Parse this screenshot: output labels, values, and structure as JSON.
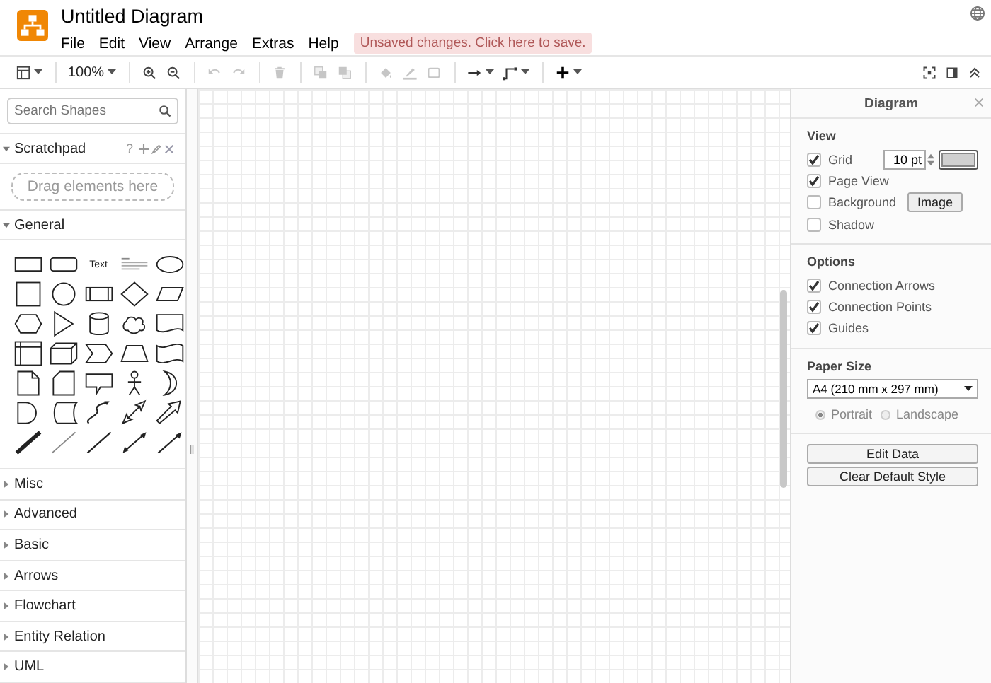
{
  "header": {
    "title": "Untitled Diagram",
    "menu": [
      "File",
      "Edit",
      "View",
      "Arrange",
      "Extras",
      "Help"
    ],
    "notice": "Unsaved changes. Click here to save."
  },
  "toolbar": {
    "zoom": "100%",
    "buttons": [
      {
        "disabled": false
      },
      {
        "disabled": false
      },
      {
        "disabled": false
      },
      {
        "disabled": true
      },
      {
        "disabled": true
      },
      {
        "disabled": true
      },
      {
        "disabled": true
      },
      {
        "disabled": true
      },
      {
        "disabled": true
      },
      {
        "disabled": true
      },
      {
        "disabled": true
      },
      {
        "disabled": false
      },
      {
        "disabled": false
      },
      {
        "disabled": false
      }
    ]
  },
  "sidebar": {
    "search": {
      "placeholder": "Search Shapes"
    },
    "scratchpad": {
      "title": "Scratchpad",
      "help": "?",
      "drop_hint": "Drag elements here",
      "expanded": true
    },
    "general": {
      "title": "General",
      "expanded": true,
      "text_shape": "Text"
    },
    "sections": [
      {
        "title": "Misc",
        "expanded": false
      },
      {
        "title": "Advanced",
        "expanded": false
      },
      {
        "title": "Basic",
        "expanded": false
      },
      {
        "title": "Arrows",
        "expanded": false
      },
      {
        "title": "Flowchart",
        "expanded": false
      },
      {
        "title": "Entity Relation",
        "expanded": false
      },
      {
        "title": "UML",
        "expanded": false
      }
    ]
  },
  "panel": {
    "title": "Diagram",
    "view": {
      "title": "View",
      "grid_size": "10 pt",
      "image_button": "Image",
      "options": [
        {
          "label": "Grid",
          "checked": true
        },
        {
          "label": "Page View",
          "checked": true
        },
        {
          "label": "Background",
          "checked": false
        },
        {
          "label": "Shadow",
          "checked": false
        }
      ]
    },
    "options": {
      "title": "Options",
      "items": [
        {
          "label": "Connection Arrows",
          "checked": true
        },
        {
          "label": "Connection Points",
          "checked": true
        },
        {
          "label": "Guides",
          "checked": true
        }
      ]
    },
    "paper": {
      "title": "Paper Size",
      "value": "A4 (210 mm x 297 mm)",
      "orientations": [
        {
          "label": "Portrait",
          "selected": true
        },
        {
          "label": "Landscape",
          "selected": false
        }
      ]
    },
    "buttons": [
      "Edit Data",
      "Clear Default Style"
    ]
  }
}
